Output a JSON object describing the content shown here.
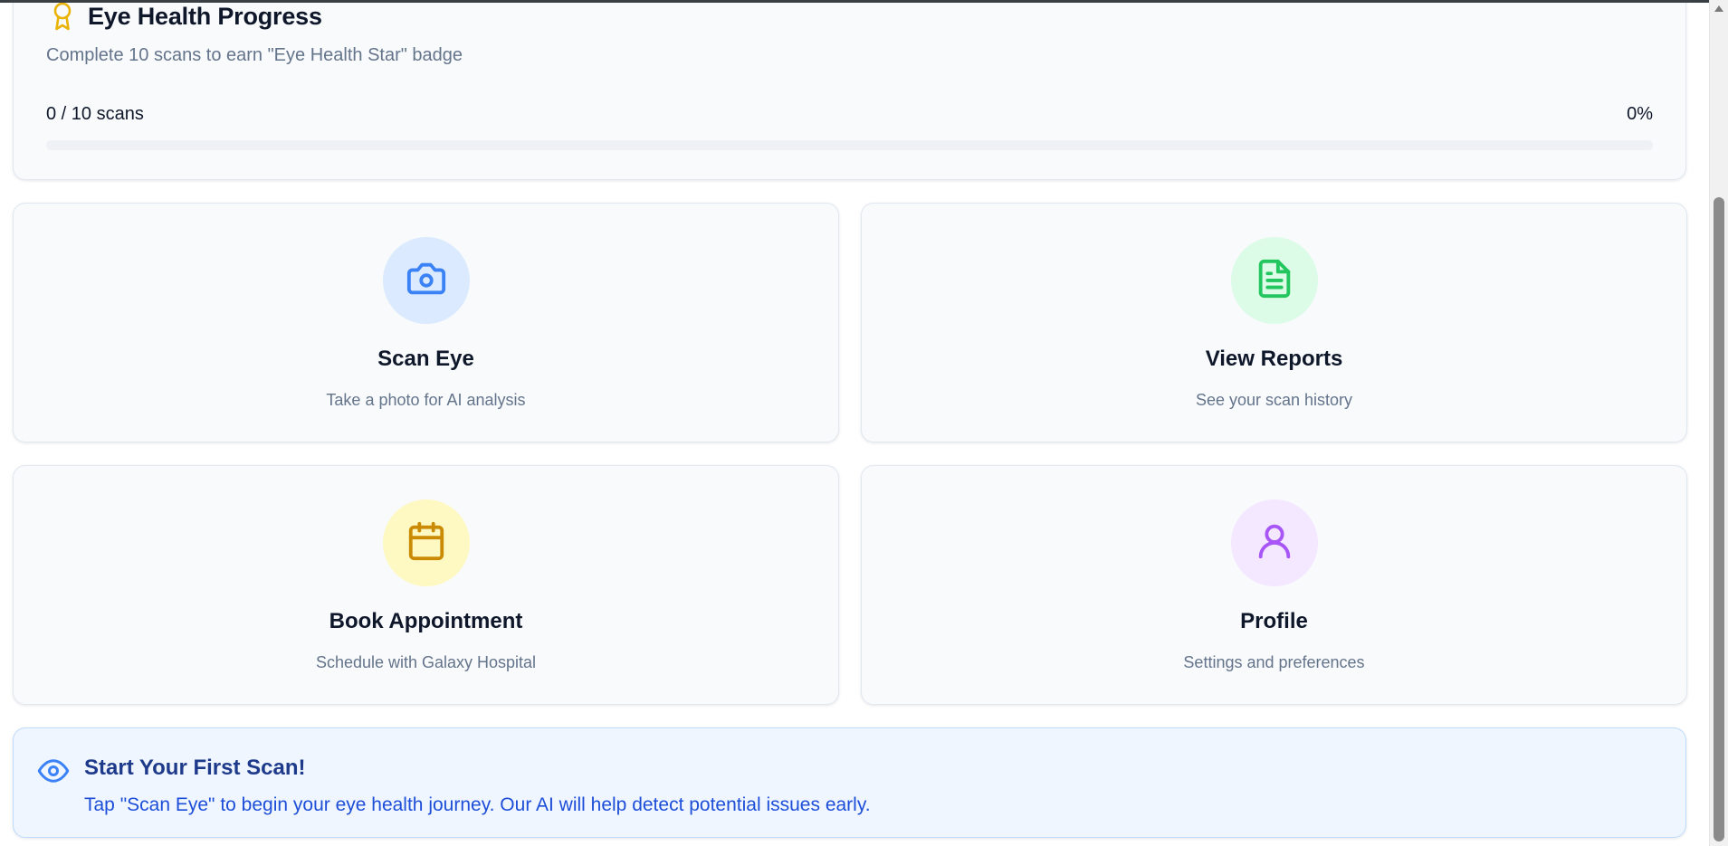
{
  "progress": {
    "title": "Eye Health Progress",
    "subtitle": "Complete 10 scans to earn \"Eye Health Star\" badge",
    "count_text": "0 / 10 scans",
    "percent_text": "0%",
    "value": 0,
    "icon": "award-icon",
    "accent_color": "#eab308"
  },
  "actions": [
    {
      "title": "Scan Eye",
      "description": "Take a photo for AI analysis",
      "icon": "camera-icon",
      "icon_color": "#3b82f6",
      "bg_color": "#dbeafe"
    },
    {
      "title": "View Reports",
      "description": "See your scan history",
      "icon": "file-text-icon",
      "icon_color": "#22c55e",
      "bg_color": "#dcfce7"
    },
    {
      "title": "Book Appointment",
      "description": "Schedule with Galaxy Hospital",
      "icon": "calendar-icon",
      "icon_color": "#ca8a04",
      "bg_color": "#fef9c3"
    },
    {
      "title": "Profile",
      "description": "Settings and preferences",
      "icon": "user-icon",
      "icon_color": "#a855f7",
      "bg_color": "#f3e8ff"
    }
  ],
  "tip": {
    "title": "Start Your First Scan!",
    "text": "Tap \"Scan Eye\" to begin your eye health journey. Our AI will help detect potential issues early.",
    "icon": "eye-icon",
    "color": "#1d4ed8"
  }
}
